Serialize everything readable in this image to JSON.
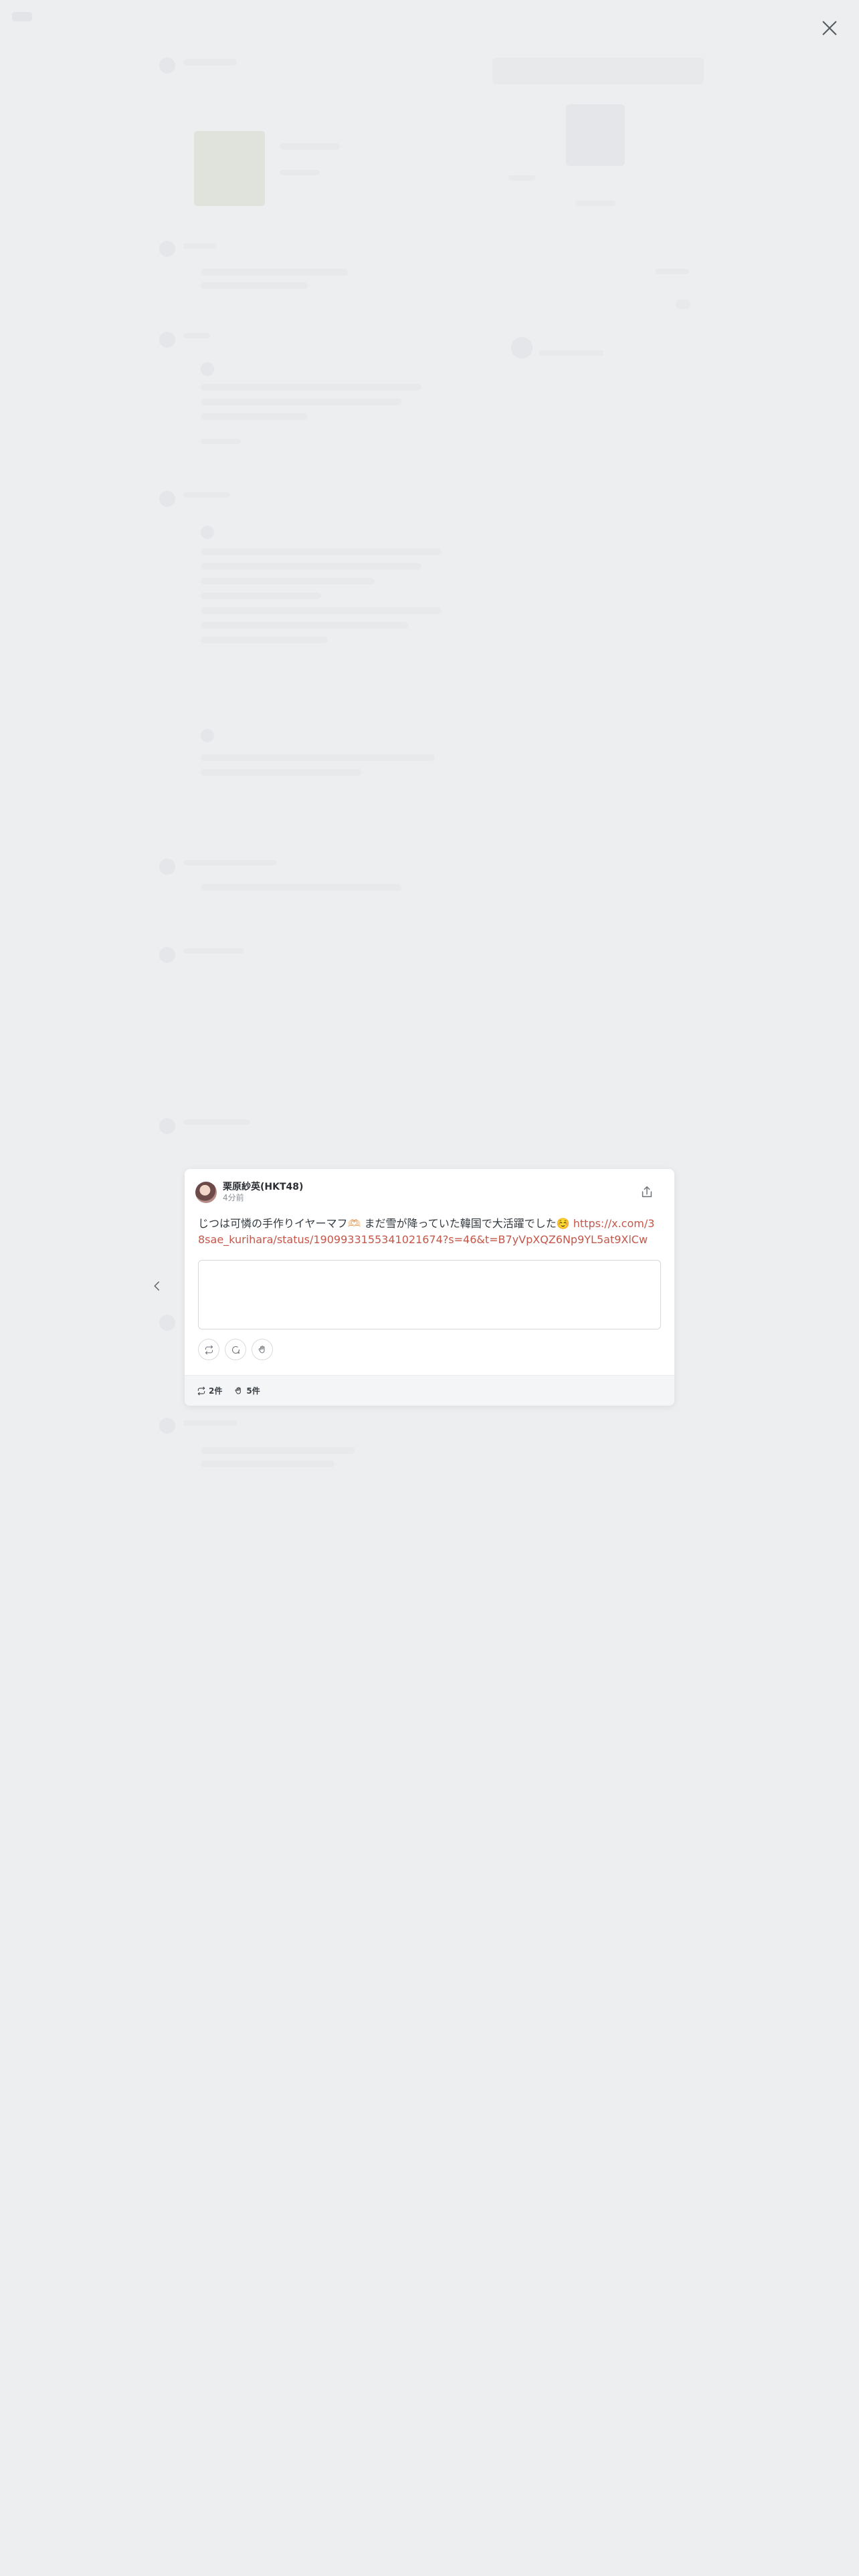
{
  "modal": {
    "author": "栗原紗英(HKT48)",
    "time": "4分前",
    "text": "じつは可憐の手作りイヤーマフ🫶🏻 まだ雪が降っていた韓国で大活躍でした☺️",
    "link": "https://x.com/38sae_kurihara/status/1909933155341021674?s=46&t=B7yVpXQZ6Np9YL5at9XlCw",
    "stats": {
      "repost_count": "2件",
      "like_count": "5件"
    }
  },
  "icons": {
    "close": "close-icon",
    "prev": "chevron-left-icon",
    "share": "share-icon",
    "repost": "repost-icon",
    "comment": "comment-icon",
    "like": "clap-icon"
  },
  "colors": {
    "background": "#eceef0",
    "link": "#c4574a",
    "card": "#ffffff"
  }
}
